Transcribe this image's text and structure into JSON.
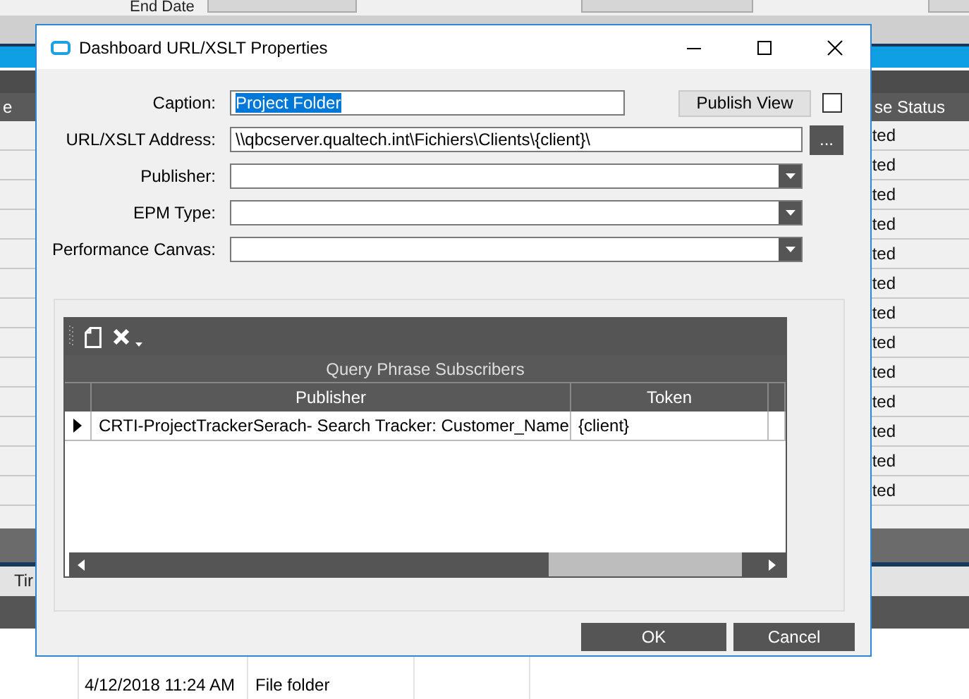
{
  "background": {
    "filter_label": "End Date",
    "left_header": "e",
    "status_header": "se Status",
    "status_cells": [
      "ted",
      "ted",
      "ted",
      "ted",
      "ted",
      "ted",
      "ted",
      "ted",
      "ted",
      "ted",
      "ted",
      "ted",
      "ted"
    ],
    "bottom_tab": "Tir",
    "files": [
      {
        "date": "4/12/2018 11:24 AM",
        "type": "File folder"
      }
    ]
  },
  "dialog": {
    "title": "Dashboard URL/XSLT Properties",
    "fields": [
      {
        "kind": "text",
        "label": "Caption:",
        "value": "Project Folder",
        "selected": true
      },
      {
        "kind": "path",
        "label": "URL/XSLT Address:",
        "value": "\\\\qbcserver.qualtech.int\\Fichiers\\Clients\\{client}\\",
        "selected": false
      },
      {
        "kind": "combo",
        "label": "Publisher:"
      },
      {
        "kind": "combo",
        "label": "EPM Type:"
      },
      {
        "kind": "combo",
        "label": "Performance Canvas:"
      }
    ],
    "publish_button": "Publish View",
    "publish_checked": false,
    "browse_button": "...",
    "grid": {
      "band": "Query Phrase Subscribers",
      "columns": [
        "Publisher",
        "Token"
      ],
      "rows": [
        {
          "publisher": "CRTI-ProjectTrackerSerach- Search Tracker: Customer_Name",
          "token": "{client}",
          "current": true
        }
      ]
    },
    "buttons": [
      "OK",
      "Cancel"
    ]
  }
}
